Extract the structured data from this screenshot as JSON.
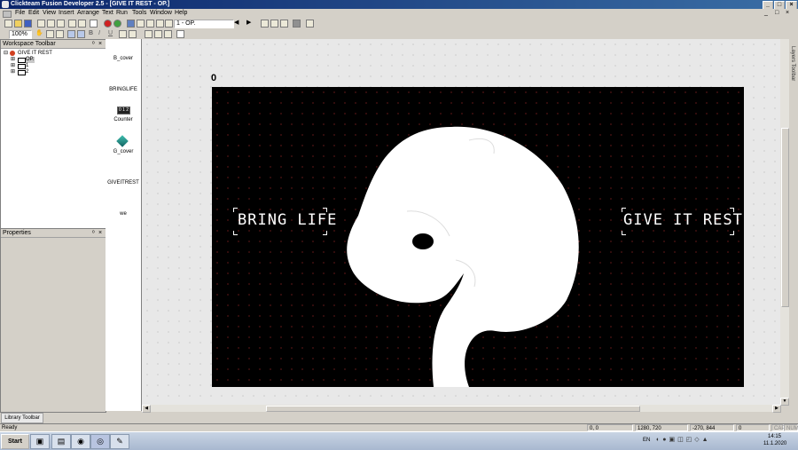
{
  "app": {
    "title": "Clickteam Fusion Developer 2.5 - [GIVE IT REST - OP.]",
    "window_buttons": [
      "_",
      "□",
      "×"
    ]
  },
  "menu": {
    "items": [
      "File",
      "Edit",
      "View",
      "Insert",
      "Arrange",
      "Text",
      "Run",
      "Tools",
      "Window",
      "Help"
    ],
    "child_buttons": [
      "_",
      "□",
      "×"
    ]
  },
  "toolbar": {
    "frame_select": "1 - OP.",
    "zoom": "100%"
  },
  "workspace": {
    "title": "Workspace Toolbar",
    "pin": "ᵒ",
    "close": "×",
    "tree": [
      {
        "label": "GIVE IT REST",
        "expander": "⊟"
      },
      {
        "label": "OP.",
        "expander": "⊞"
      },
      {
        "label": "1",
        "expander": "⊞"
      },
      {
        "label": "2",
        "expander": "⊞"
      }
    ]
  },
  "properties": {
    "title": "Properties",
    "pin": "ᵒ",
    "close": "×"
  },
  "objects": [
    {
      "label": "B_cover"
    },
    {
      "label": "BRINGLIFE"
    },
    {
      "label": "Counter"
    },
    {
      "label": "G_cover"
    },
    {
      "label": "GIVEITREST"
    },
    {
      "label": "we"
    }
  ],
  "editor": {
    "counter_value": "0",
    "left_button": "BRING LIFE",
    "right_button": "GIVE IT REST",
    "layers_tab": "Layers Toolbar"
  },
  "library": {
    "tab": "Library Toolbar"
  },
  "status": {
    "left": "Ready",
    "mouse": "0, 0",
    "size": "1280, 720",
    "coords": "-270, 844",
    "value": "0",
    "caps": "CAP",
    "num": "NUM"
  },
  "taskbar": {
    "start": "Start",
    "lang": "EN",
    "time": "14:15",
    "date": "11.1.2020"
  }
}
